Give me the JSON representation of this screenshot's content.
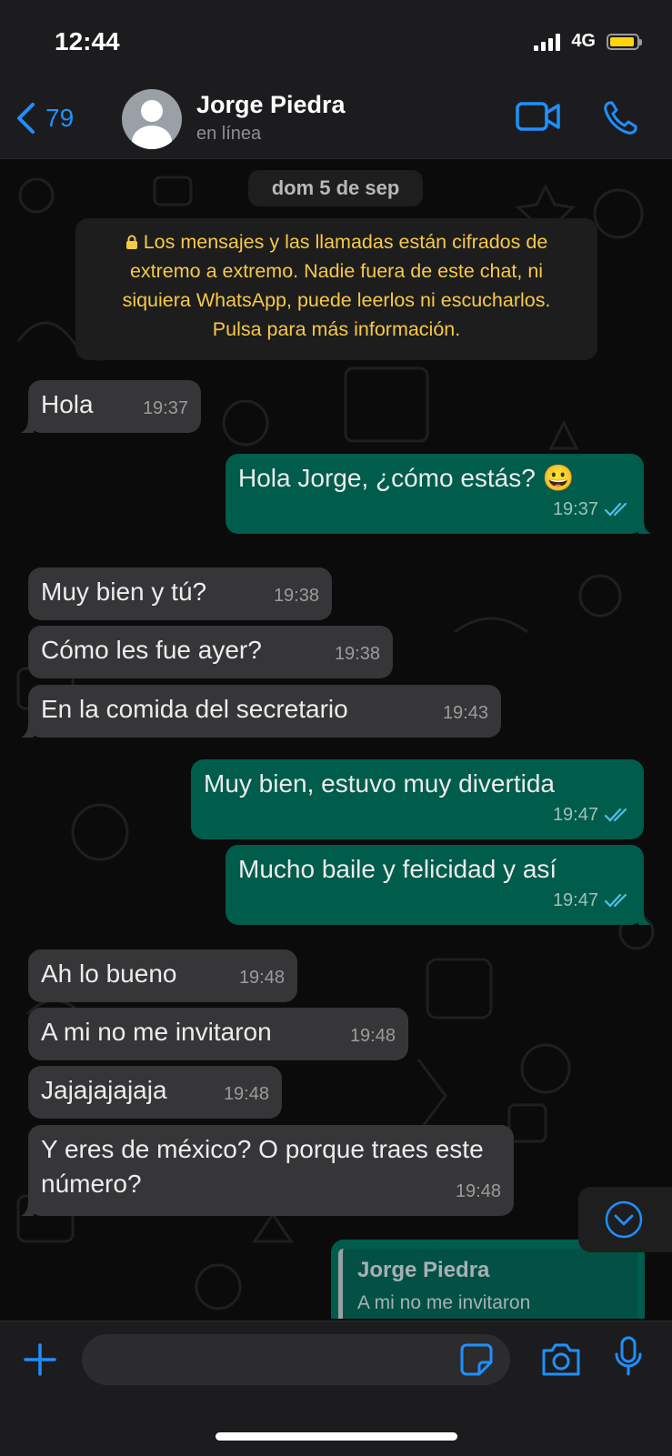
{
  "status_bar": {
    "time": "12:44",
    "network": "4G"
  },
  "header": {
    "back_count": "79",
    "contact_name": "Jorge Piedra",
    "contact_status": "en línea"
  },
  "chat": {
    "date_chip": "dom 5 de sep",
    "encryption_notice": "Los mensajes y las llamadas están cifrados de extremo a extremo. Nadie fuera de este chat, ni siquiera WhatsApp, puede leerlos ni escucharlos. Pulsa para más información.",
    "messages": [
      {
        "direction": "in",
        "text": "Hola",
        "time": "19:37"
      },
      {
        "direction": "out",
        "text": "Hola Jorge, ¿cómo estás? 😀",
        "time": "19:37",
        "read": true
      },
      {
        "direction": "in",
        "text": "Muy bien y tú?",
        "time": "19:38"
      },
      {
        "direction": "in",
        "text": "Cómo les fue ayer?",
        "time": "19:38"
      },
      {
        "direction": "in",
        "text": "En la comida del secretario",
        "time": "19:43"
      },
      {
        "direction": "out",
        "text": "Muy bien, estuvo muy divertida",
        "time": "19:47",
        "read": true
      },
      {
        "direction": "out",
        "text": "Mucho baile y felicidad y así",
        "time": "19:47",
        "read": true
      },
      {
        "direction": "in",
        "text": "Ah lo bueno",
        "time": "19:48"
      },
      {
        "direction": "in",
        "text": "A mi no me invitaron",
        "time": "19:48"
      },
      {
        "direction": "in",
        "text": "Jajajajajaja",
        "time": "19:48"
      },
      {
        "direction": "in",
        "text": "Y eres de méxico? O porque traes este número?",
        "time": "19:48"
      }
    ],
    "reply_preview": {
      "name": "Jorge Piedra",
      "text": "A mi no me invitaron"
    }
  },
  "colors": {
    "accent": "#1e90ff",
    "outgoing_bubble": "#005c4b",
    "incoming_bubble": "#363638",
    "notice_text": "#f7c948",
    "read_ticks": "#53bdeb"
  },
  "icons": {
    "back": "chevron-left-icon",
    "video_call": "video-camera-icon",
    "voice_call": "phone-icon",
    "attach": "plus-icon",
    "sticker": "sticker-icon",
    "camera": "camera-icon",
    "mic": "microphone-icon",
    "scroll_down": "chevron-down-circle-icon"
  }
}
